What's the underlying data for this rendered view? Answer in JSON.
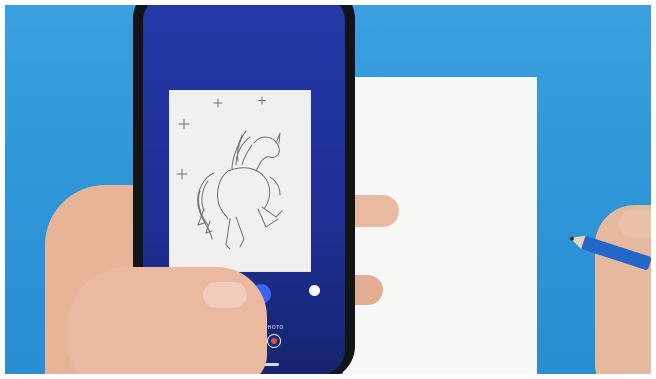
{
  "scene": {
    "background_color": "#2f96d8",
    "phone_screen_color": "#1e2f94",
    "paper_color": "#f7f7f5",
    "pencil_color": "#2368c9"
  },
  "camera_ui": {
    "mode_label": "PHOTO",
    "shutter_icon": "circle-outline-icon",
    "record_icon": "record-icon"
  }
}
